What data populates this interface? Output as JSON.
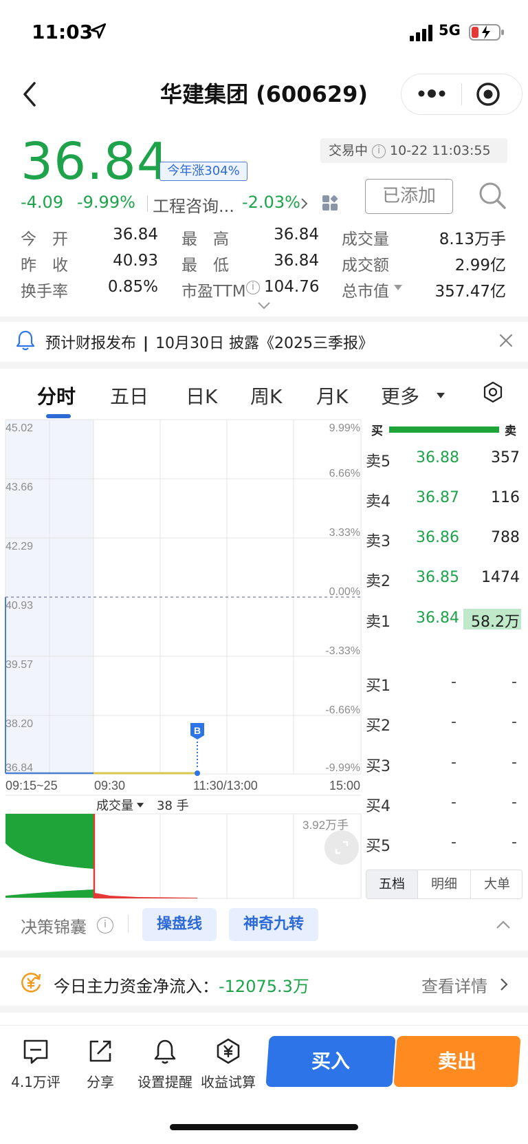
{
  "status_bar": {
    "time": "11:03",
    "network": "5G"
  },
  "header": {
    "title": "华建集团 (600629)"
  },
  "quote": {
    "price": "36.84",
    "year_badge": "今年涨304%",
    "trade_status": "交易中",
    "datetime": "10-22 11:03:55",
    "change": "-4.09",
    "change_pct": "-9.99%",
    "sector_name": "工程咨询...",
    "sector_change": "-2.03%",
    "added_label": "已添加"
  },
  "stats": {
    "open_label": "今　开",
    "open_value": "36.84",
    "high_label": "最　高",
    "high_value": "36.84",
    "volume_label": "成交量",
    "volume_value": "8.13万手",
    "prev_close_label": "昨　收",
    "prev_close_value": "40.93",
    "low_label": "最　低",
    "low_value": "36.84",
    "turnover_label": "成交额",
    "turnover_value": "2.99亿",
    "turnover_rate_label": "换手率",
    "turnover_rate_value": "0.85%",
    "pe_label": "市盈TTM",
    "pe_value": "104.76",
    "mcap_label": "总市值",
    "mcap_value": "357.47亿"
  },
  "notice": {
    "title": "预计财报发布",
    "detail": "10月30日 披露《2025三季报》"
  },
  "tabs": [
    "分时",
    "五日",
    "日K",
    "周K",
    "月K",
    "更多"
  ],
  "chart": {
    "left_axis": [
      "45.02",
      "43.66",
      "42.29",
      "40.93",
      "39.57",
      "38.20",
      "36.84"
    ],
    "right_axis": [
      "9.99%",
      "6.66%",
      "3.33%",
      "0.00%",
      "-3.33%",
      "-6.66%",
      "-9.99%"
    ],
    "time_labels": [
      "09:15~25",
      "09:30",
      "11:30/13:00",
      "15:00"
    ],
    "marker": "B",
    "volume_label": "成交量",
    "volume_value": "38 手",
    "volume_max": "3.92万手"
  },
  "chart_data": {
    "type": "line",
    "title": "",
    "xlabel": "",
    "ylabel": "",
    "x": [
      "09:15",
      "09:25",
      "09:30",
      "11:03"
    ],
    "series": [
      {
        "values": [
          36.84,
          36.84,
          36.84,
          36.84
        ]
      }
    ],
    "ylim": [
      36.84,
      45.02
    ],
    "prev_close": 40.93,
    "y_ticks": [
      45.02,
      43.66,
      42.29,
      40.93,
      39.57,
      38.2,
      36.84
    ],
    "y2_ticks": [
      "9.99%",
      "6.66%",
      "3.33%",
      "0.00%",
      "-3.33%",
      "-6.66%",
      "-9.99%"
    ],
    "grid": true
  },
  "order_book": {
    "head_buy": "买",
    "head_sell": "卖",
    "asks": [
      {
        "label": "卖5",
        "price": "36.88",
        "volume": "357"
      },
      {
        "label": "卖4",
        "price": "36.87",
        "volume": "116"
      },
      {
        "label": "卖3",
        "price": "36.86",
        "volume": "788"
      },
      {
        "label": "卖2",
        "price": "36.85",
        "volume": "1474"
      },
      {
        "label": "卖1",
        "price": "36.84",
        "volume": "58.2万"
      }
    ],
    "bids": [
      {
        "label": "买1",
        "price": "-",
        "volume": "-"
      },
      {
        "label": "买2",
        "price": "-",
        "volume": "-"
      },
      {
        "label": "买3",
        "price": "-",
        "volume": "-"
      },
      {
        "label": "买4",
        "price": "-",
        "volume": "-"
      },
      {
        "label": "买5",
        "price": "-",
        "volume": "-"
      }
    ],
    "tabs": [
      "五档",
      "明细",
      "大单"
    ]
  },
  "decision": {
    "title": "决策锦囊",
    "pill1": "操盘线",
    "pill2": "神奇九转"
  },
  "fund_flow": {
    "label": "今日主力资金净流入：",
    "value": "-12075.3万",
    "link": "查看详情"
  },
  "bottom": {
    "comments": "4.1万评",
    "share": "分享",
    "alert": "设置提醒",
    "calc": "收益试算",
    "buy": "买入",
    "sell": "卖出"
  },
  "colors": {
    "up_down_green": "#1ea34a",
    "accent_blue": "#2d74e8",
    "sell_orange": "#ff8a1f"
  }
}
